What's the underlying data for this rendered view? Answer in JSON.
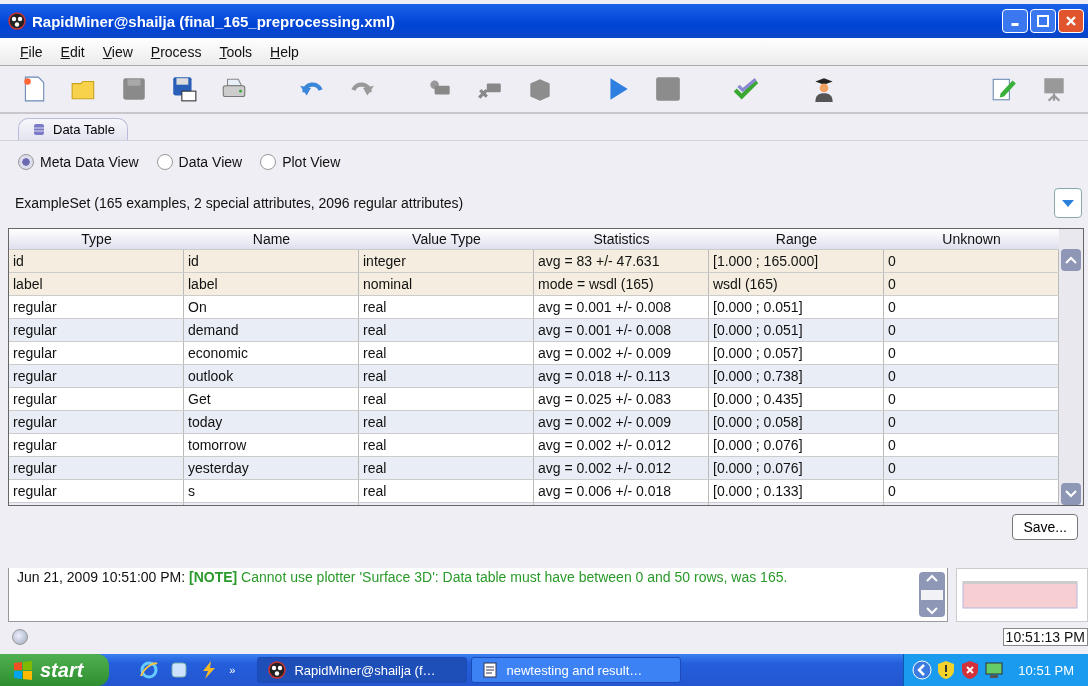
{
  "window": {
    "title": "RapidMiner@shailja (final_165_preprocessing.xml)"
  },
  "menu": [
    "File",
    "Edit",
    "View",
    "Process",
    "Tools",
    "Help"
  ],
  "tab": {
    "label": "Data Table",
    "selected": true
  },
  "views": [
    {
      "label": "Meta Data View",
      "selected": true
    },
    {
      "label": "Data View",
      "selected": false
    },
    {
      "label": "Plot View",
      "selected": false
    }
  ],
  "summary": "ExampleSet (165 examples, 2 special attributes, 2096 regular attributes)",
  "table": {
    "columns": [
      "Type",
      "Name",
      "Value Type",
      "Statistics",
      "Range",
      "Unknown"
    ],
    "rows": [
      {
        "special": true,
        "cells": [
          "id",
          "id",
          "integer",
          "avg = 83 +/- 47.631",
          "[1.000 ; 165.000]",
          "0"
        ]
      },
      {
        "special": true,
        "cells": [
          "label",
          "label",
          "nominal",
          "mode = wsdl (165)",
          "wsdl (165)",
          "0"
        ]
      },
      {
        "special": false,
        "cells": [
          "regular",
          "On",
          "real",
          "avg = 0.001 +/- 0.008",
          "[0.000 ; 0.051]",
          "0"
        ]
      },
      {
        "special": false,
        "cells": [
          "regular",
          "demand",
          "real",
          "avg = 0.001 +/- 0.008",
          "[0.000 ; 0.051]",
          "0"
        ]
      },
      {
        "special": false,
        "cells": [
          "regular",
          "economic",
          "real",
          "avg = 0.002 +/- 0.009",
          "[0.000 ; 0.057]",
          "0"
        ]
      },
      {
        "special": false,
        "cells": [
          "regular",
          "outlook",
          "real",
          "avg = 0.018 +/- 0.113",
          "[0.000 ; 0.738]",
          "0"
        ]
      },
      {
        "special": false,
        "cells": [
          "regular",
          "Get",
          "real",
          "avg = 0.025 +/- 0.083",
          "[0.000 ; 0.435]",
          "0"
        ]
      },
      {
        "special": false,
        "cells": [
          "regular",
          "today",
          "real",
          "avg = 0.002 +/- 0.009",
          "[0.000 ; 0.058]",
          "0"
        ]
      },
      {
        "special": false,
        "cells": [
          "regular",
          "tomorrow",
          "real",
          "avg = 0.002 +/- 0.012",
          "[0.000 ; 0.076]",
          "0"
        ]
      },
      {
        "special": false,
        "cells": [
          "regular",
          "yesterday",
          "real",
          "avg = 0.002 +/- 0.012",
          "[0.000 ; 0.076]",
          "0"
        ]
      },
      {
        "special": false,
        "cells": [
          "regular",
          "s",
          "real",
          "avg = 0.006 +/- 0.018",
          "[0.000 ; 0.133]",
          "0"
        ]
      }
    ]
  },
  "save_button": "Save...",
  "log": {
    "time": "Jun 21, 2009 10:51:00 PM:",
    "message": "**[NOTE]** Cannot use plotter 'Surface 3D': Data table must have between 0 and 50 rows, was 165."
  },
  "status_bar": {
    "clock": "10:51:13 PM"
  },
  "taskbar": {
    "start": "start",
    "more": "»",
    "tasks": [
      {
        "label": "RapidMiner@shailja (f…",
        "selected": true
      },
      {
        "label": "newtesting and result…",
        "selected": false
      }
    ],
    "clock": "10:51 PM"
  }
}
